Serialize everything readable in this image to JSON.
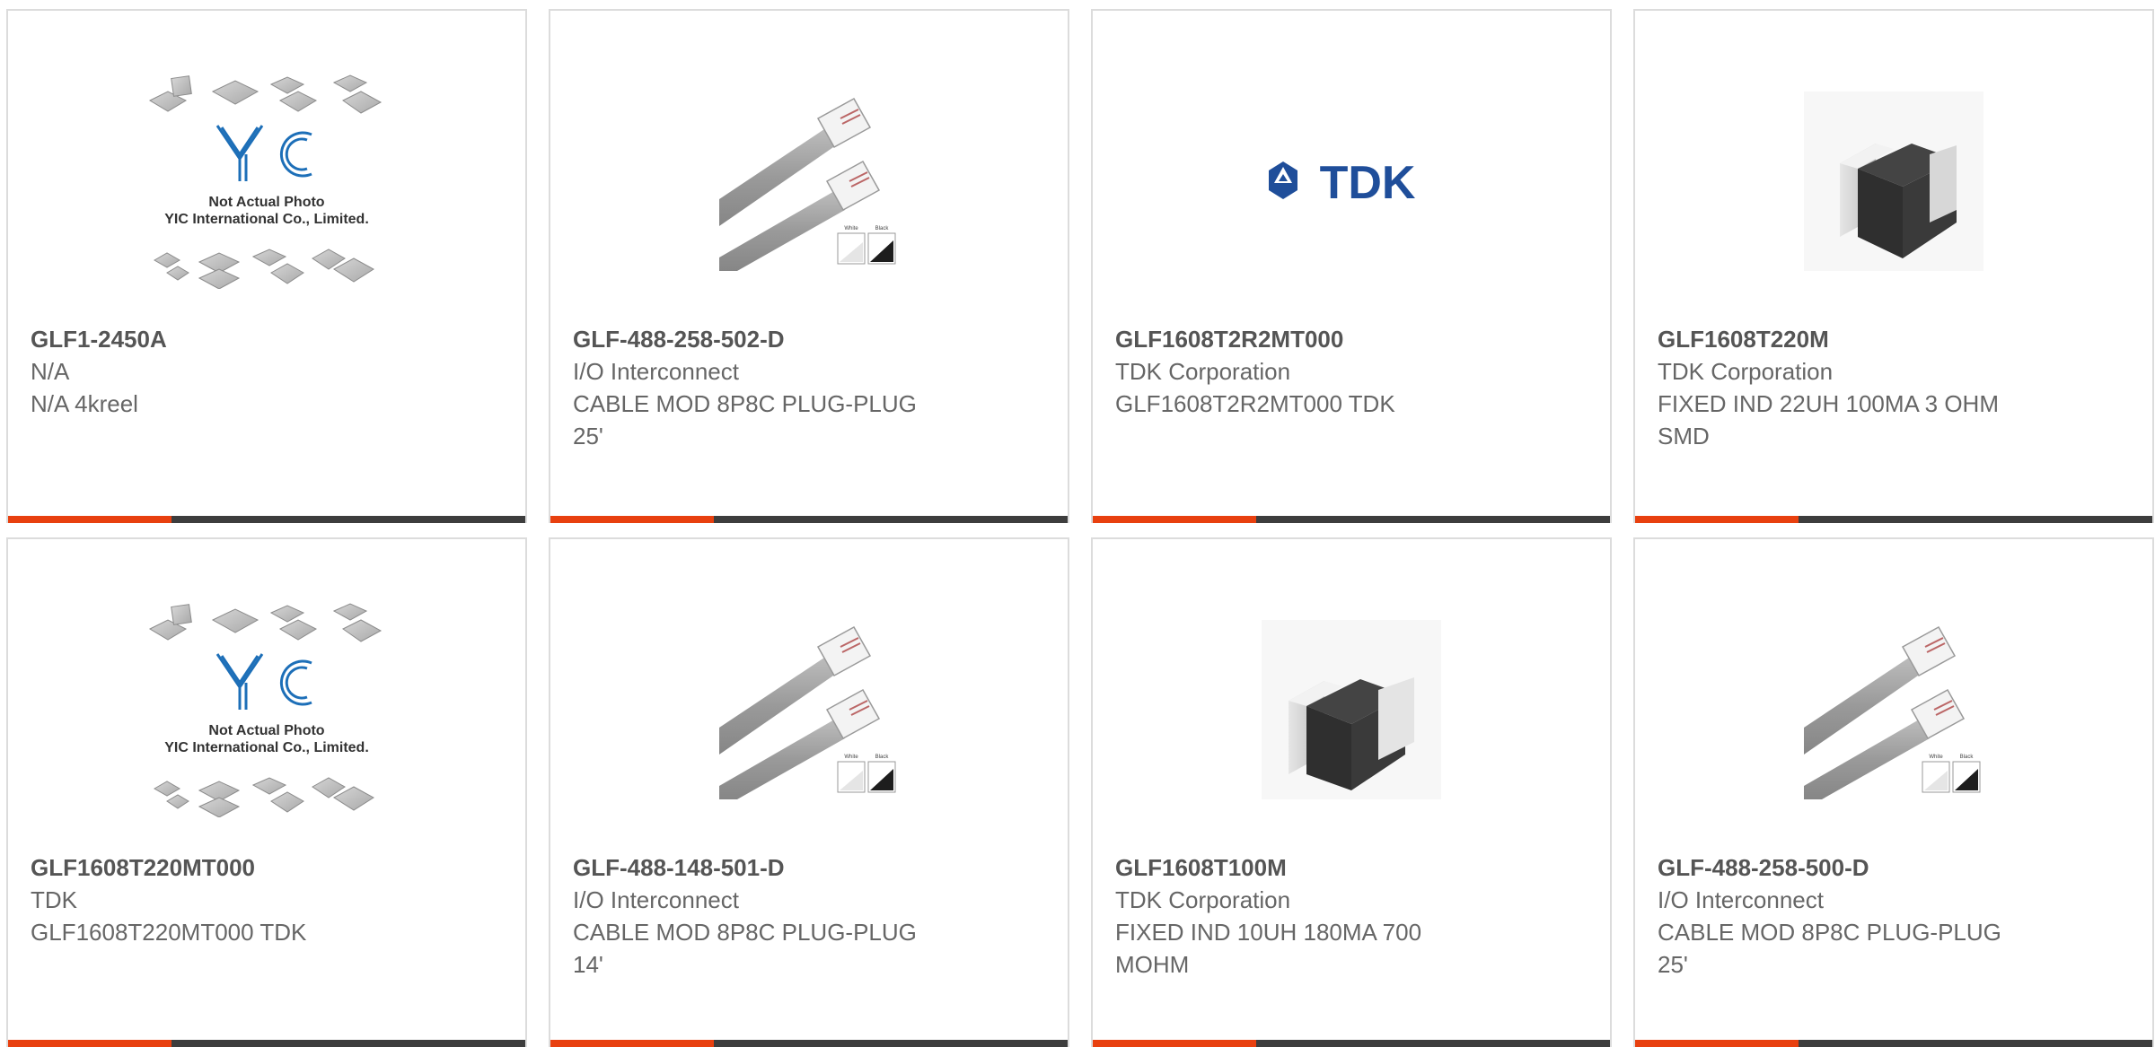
{
  "accent_color": "#e8400f",
  "bar_color": "#3d3d3d",
  "placeholder": {
    "line1": "Not Actual Photo",
    "line2": "YIC International Co., Limited.",
    "logo": "YIC"
  },
  "cable_swatch": {
    "white": "White",
    "black": "Black"
  },
  "tdk_logo_text": "TDK",
  "products": [
    {
      "pn": "GLF1-2450A",
      "mfr": "N/A",
      "desc": "N/A 4kreel",
      "image": "yic-placeholder-image"
    },
    {
      "pn": "GLF-488-258-502-D",
      "mfr": "I/O Interconnect",
      "desc": "CABLE MOD 8P8C PLUG-PLUG 25'",
      "image": "cable-image"
    },
    {
      "pn": "GLF1608T2R2MT000",
      "mfr": "TDK Corporation",
      "desc": "GLF1608T2R2MT000 TDK",
      "image": "tdk-logo"
    },
    {
      "pn": "GLF1608T220M",
      "mfr": "TDK Corporation",
      "desc": "FIXED IND 22UH 100MA 3 OHM SMD",
      "image": "inductor-image"
    },
    {
      "pn": "GLF1608T220MT000",
      "mfr": "TDK",
      "desc": "GLF1608T220MT000 TDK",
      "image": "yic-placeholder-image"
    },
    {
      "pn": "GLF-488-148-501-D",
      "mfr": "I/O Interconnect",
      "desc": "CABLE MOD 8P8C PLUG-PLUG 14'",
      "image": "cable-image"
    },
    {
      "pn": "GLF1608T100M",
      "mfr": "TDK Corporation",
      "desc": "FIXED IND 10UH 180MA 700 MOHM",
      "image": "inductor-image"
    },
    {
      "pn": "GLF-488-258-500-D",
      "mfr": "I/O Interconnect",
      "desc": "CABLE MOD 8P8C PLUG-PLUG 25'",
      "image": "cable-image"
    }
  ]
}
